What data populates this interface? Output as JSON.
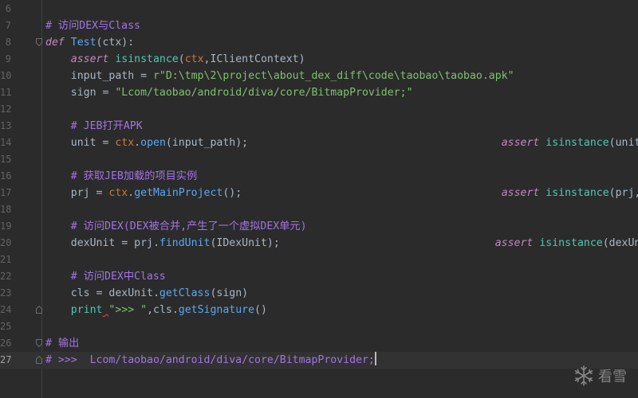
{
  "editor": {
    "lines": [
      {
        "num": "6",
        "tokens": []
      },
      {
        "num": "7",
        "tokens": [
          {
            "t": "# 访问DEX与Class",
            "c": "c-comment"
          }
        ]
      },
      {
        "num": "8",
        "fold": "open",
        "tokens": [
          {
            "t": "def ",
            "c": "c-kw"
          },
          {
            "t": "Test",
            "c": "c-fn"
          },
          {
            "t": "(ctx):",
            "c": "c-plain"
          }
        ]
      },
      {
        "num": "9",
        "tokens": [
          {
            "t": "    ",
            "c": "c-plain"
          },
          {
            "t": "assert ",
            "c": "c-kw"
          },
          {
            "t": "isinstance",
            "c": "c-builtin"
          },
          {
            "t": "(",
            "c": "c-plain"
          },
          {
            "t": "ctx",
            "c": "c-self"
          },
          {
            "t": ",IClientContext)",
            "c": "c-plain"
          }
        ]
      },
      {
        "num": "10",
        "tokens": [
          {
            "t": "    input_path = ",
            "c": "c-plain"
          },
          {
            "t": "r\"D:\\tmp\\2\\project\\about_dex_diff\\code\\taobao\\taobao.apk\"",
            "c": "c-str"
          }
        ]
      },
      {
        "num": "11",
        "tokens": [
          {
            "t": "    sign = ",
            "c": "c-plain"
          },
          {
            "t": "\"Lcom/taobao/android/diva/core/BitmapProvider;\"",
            "c": "c-str"
          }
        ]
      },
      {
        "num": "12",
        "tokens": []
      },
      {
        "num": "13",
        "tokens": [
          {
            "t": "    # JEB打开APK",
            "c": "c-comment"
          }
        ]
      },
      {
        "num": "14",
        "tokens": [
          {
            "t": "    unit = ",
            "c": "c-plain"
          },
          {
            "t": "ctx",
            "c": "c-self"
          },
          {
            "t": ".",
            "c": "c-plain"
          },
          {
            "t": "open",
            "c": "c-fn"
          },
          {
            "t": "(input_path);                                        ",
            "c": "c-plain"
          },
          {
            "t": "assert ",
            "c": "c-kw"
          },
          {
            "t": "isinstance",
            "c": "c-builtin"
          },
          {
            "t": "(unit,IUnit)",
            "c": "c-plain"
          }
        ]
      },
      {
        "num": "15",
        "tokens": []
      },
      {
        "num": "16",
        "tokens": [
          {
            "t": "    # 获取JEB加载的项目实例",
            "c": "c-comment"
          }
        ]
      },
      {
        "num": "17",
        "tokens": [
          {
            "t": "    prj = ",
            "c": "c-plain"
          },
          {
            "t": "ctx",
            "c": "c-self"
          },
          {
            "t": ".",
            "c": "c-plain"
          },
          {
            "t": "getMainProject",
            "c": "c-fn"
          },
          {
            "t": "();                                         ",
            "c": "c-plain"
          },
          {
            "t": "assert ",
            "c": "c-kw"
          },
          {
            "t": "isinstance",
            "c": "c-builtin"
          },
          {
            "t": "(prj,IRuntimeProject)",
            "c": "c-plain"
          }
        ]
      },
      {
        "num": "18",
        "tokens": []
      },
      {
        "num": "19",
        "tokens": [
          {
            "t": "    # 访问DEX(DEX被合并,产生了一个虚拟DEX单元)",
            "c": "c-comment"
          }
        ]
      },
      {
        "num": "20",
        "tokens": [
          {
            "t": "    dexUnit = prj.",
            "c": "c-plain"
          },
          {
            "t": "findUnit",
            "c": "c-fn"
          },
          {
            "t": "(IDexUnit);                                  ",
            "c": "c-plain"
          },
          {
            "t": "assert ",
            "c": "c-kw"
          },
          {
            "t": "isinstance",
            "c": "c-builtin"
          },
          {
            "t": "(dexUnit,IDexUnit)",
            "c": "c-plain"
          }
        ]
      },
      {
        "num": "21",
        "tokens": []
      },
      {
        "num": "22",
        "tokens": [
          {
            "t": "    # 访问DEX中Class",
            "c": "c-comment"
          }
        ]
      },
      {
        "num": "23",
        "tokens": [
          {
            "t": "    cls = dexUnit.",
            "c": "c-plain"
          },
          {
            "t": "getClass",
            "c": "c-fn"
          },
          {
            "t": "(sign)",
            "c": "c-plain"
          }
        ]
      },
      {
        "num": "24",
        "fold": "close",
        "tokens": [
          {
            "t": "    ",
            "c": "c-plain"
          },
          {
            "t": "print",
            "c": "c-print"
          },
          {
            "t": " ",
            "c": "c-plain squiggle"
          },
          {
            "t": "\">>> \"",
            "c": "c-str"
          },
          {
            "t": ",cls.",
            "c": "c-plain"
          },
          {
            "t": "getSignature",
            "c": "c-fn"
          },
          {
            "t": "()",
            "c": "c-plain"
          }
        ]
      },
      {
        "num": "25",
        "tokens": []
      },
      {
        "num": "26",
        "fold": "open",
        "tokens": [
          {
            "t": "# 输出",
            "c": "c-comment"
          }
        ]
      },
      {
        "num": "27",
        "fold": "close",
        "current": true,
        "tokens": [
          {
            "t": "# >>>  Lcom/taobao/android/diva/core/BitmapProvider;",
            "c": "c-comment"
          }
        ]
      }
    ]
  },
  "watermark": {
    "icon": "snowflake-icon",
    "text": "看雪"
  }
}
